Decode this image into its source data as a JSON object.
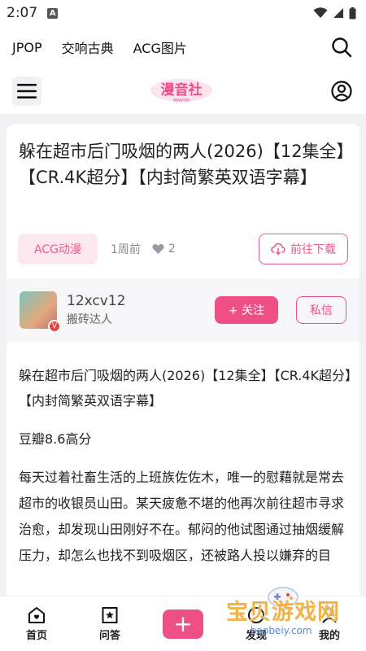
{
  "status": {
    "time": "2:07",
    "a_badge": "A"
  },
  "topnav": {
    "items": [
      "JPOP",
      "交响古典",
      "ACG图片"
    ]
  },
  "header": {
    "logo_text": "漫音社",
    "logo_sub": "MANYIN"
  },
  "post": {
    "title": "躲在超市后门吸烟的两人(2026)【12集全】【CR.4K超分】【内封简繁英双语字幕】",
    "tag": "ACG动漫",
    "time": "1周前",
    "likes": "2",
    "download_label": "前往下载"
  },
  "author": {
    "name": "12xcv12",
    "role": "搬砖达人",
    "badge": "V",
    "follow_label": "+ 关注",
    "message_label": "私信"
  },
  "content": {
    "p1": "躲在超市后门吸烟的两人(2026)【12集全】【CR.4K超分】【内封简繁英双语字幕】",
    "p2": "豆瓣8.6高分",
    "p3": "每天过着社畜生活的上班族佐佐木，唯一的慰藉就是常去超市的收银员山田。某天疲惫不堪的他再次前往超市寻求治愈，却发现山田刚好不在。郁闷的他试图通过抽烟缓解压力，却怎么也找不到吸烟区，还被路人投以嫌弃的目"
  },
  "bottom_nav": {
    "home": "首页",
    "qa": "问答",
    "plus": "+",
    "discover": "发现",
    "mine": "我的"
  },
  "watermark": {
    "text": "宝贝游戏网",
    "url": "baobeiy.com"
  },
  "colors": {
    "accent": "#ee4f85",
    "tag_bg": "#fce7ef",
    "page_bg": "#f1f1f4"
  }
}
